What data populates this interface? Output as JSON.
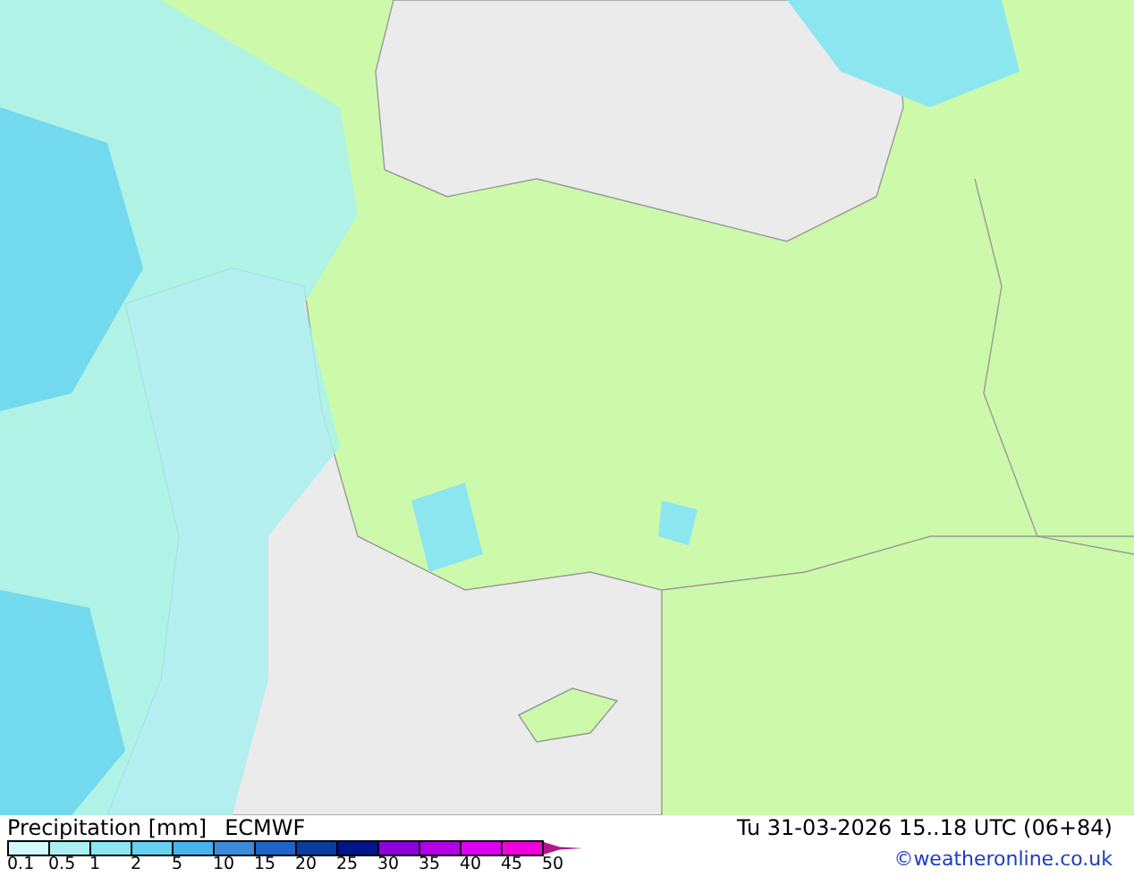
{
  "map": {
    "title": "Precipitation [mm]",
    "model": "ECMWF",
    "valid_time": "Tu 31-03-2026 15..18 UTC (06+84)",
    "credit": "©weatheronline.co.uk"
  },
  "legend": {
    "bins": [
      {
        "kind": "box",
        "color": "#d2fafa"
      },
      {
        "kind": "box",
        "color": "#aaf0f0"
      },
      {
        "kind": "box",
        "color": "#8ce6f0"
      },
      {
        "kind": "box",
        "color": "#64d2f0"
      },
      {
        "kind": "box",
        "color": "#46b4ec"
      },
      {
        "kind": "box",
        "color": "#3c8cdc"
      },
      {
        "kind": "box",
        "color": "#1e64c8"
      },
      {
        "kind": "box",
        "color": "#0a3ca0"
      },
      {
        "kind": "box",
        "color": "#00148c"
      },
      {
        "kind": "box",
        "color": "#8c00dc"
      },
      {
        "kind": "box",
        "color": "#b400e6"
      },
      {
        "kind": "box",
        "color": "#dc00f0"
      },
      {
        "kind": "box",
        "color": "#f000dc"
      },
      {
        "kind": "arrow",
        "color": "#b4148c"
      }
    ],
    "labels": [
      "0.1",
      "0.5",
      "1",
      "2",
      "5",
      "10",
      "15",
      "20",
      "25",
      "30",
      "35",
      "40",
      "45",
      "50"
    ]
  }
}
